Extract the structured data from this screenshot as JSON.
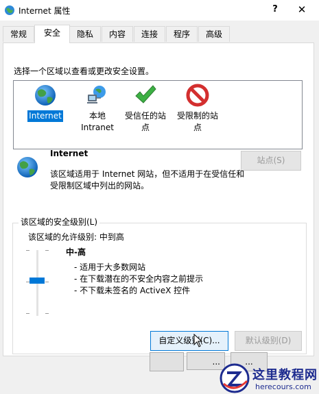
{
  "window": {
    "title": "Internet 属性",
    "help_label": "?",
    "close_label": "✕"
  },
  "tabs": [
    {
      "label": "常规"
    },
    {
      "label": "安全"
    },
    {
      "label": "隐私"
    },
    {
      "label": "内容"
    },
    {
      "label": "连接"
    },
    {
      "label": "程序"
    },
    {
      "label": "高级"
    }
  ],
  "active_tab": "安全",
  "security": {
    "instruction": "选择一个区域以查看或更改安全设置。",
    "zones": [
      {
        "label": "Internet",
        "icon": "globe-icon",
        "selected": true
      },
      {
        "label": "本地\nIntranet",
        "icon": "intranet-icon",
        "selected": false
      },
      {
        "label": "受信任的站\n点",
        "icon": "checkmark-icon",
        "selected": false
      },
      {
        "label": "受限制的站\n点",
        "icon": "restricted-icon",
        "selected": false
      }
    ],
    "detail": {
      "title": "Internet",
      "description": "该区域适用于 Internet 网站，但不适用于在受信任和受限制区域中列出的网站。",
      "sites_button": "站点(S)"
    },
    "level_group": {
      "legend": "该区域的安全级别(L)",
      "allowed": "该区域的允许级别: 中到高",
      "level_name": "中-高",
      "level_value": 0.5,
      "bullets": [
        "- 适用于大多数网站",
        "- 在下载潜在的不安全内容之前提示",
        "- 不下载未签名的 ActiveX 控件"
      ],
      "custom_button": "自定义级别(C)...",
      "default_button": "默认级别(D)"
    },
    "bottom_buttons": [
      "",
      "...",
      "..."
    ]
  },
  "watermark": {
    "title": "这里教程网",
    "url": "herecours.com"
  },
  "colors": {
    "accent": "#0078d7",
    "disabled_text": "#9a9a9a",
    "watermark": "#1d2b8f"
  }
}
